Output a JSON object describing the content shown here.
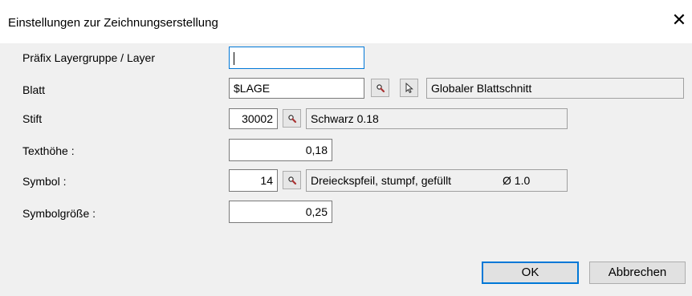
{
  "window": {
    "title": "Einstellungen zur Zeichnungserstellung"
  },
  "rows": {
    "praefix": {
      "label": "Präfix Layergruppe / Layer",
      "value": ""
    },
    "blatt": {
      "label": "Blatt",
      "value": "$LAGE",
      "description": "Globaler Blattschnitt"
    },
    "stift": {
      "label": "Stift",
      "value": "30002",
      "description": "Schwarz 0.18"
    },
    "texthoehe": {
      "label": "Texthöhe :",
      "value": "0,18"
    },
    "symbol": {
      "label": "Symbol :",
      "value": "14",
      "description": "Dreieckspfeil, stumpf, gefüllt",
      "extra": "Ø 1.0"
    },
    "symbolgroesse": {
      "label": "Symbolgröße :",
      "value": "0,25"
    }
  },
  "buttons": {
    "ok": "OK",
    "cancel": "Abbrechen"
  },
  "icons": {
    "close": "close-icon",
    "search": "magnifier-icon",
    "pick": "cursor-arrow-icon"
  },
  "colors": {
    "focus": "#0078d7",
    "dialog_bg": "#f0f0f0"
  }
}
